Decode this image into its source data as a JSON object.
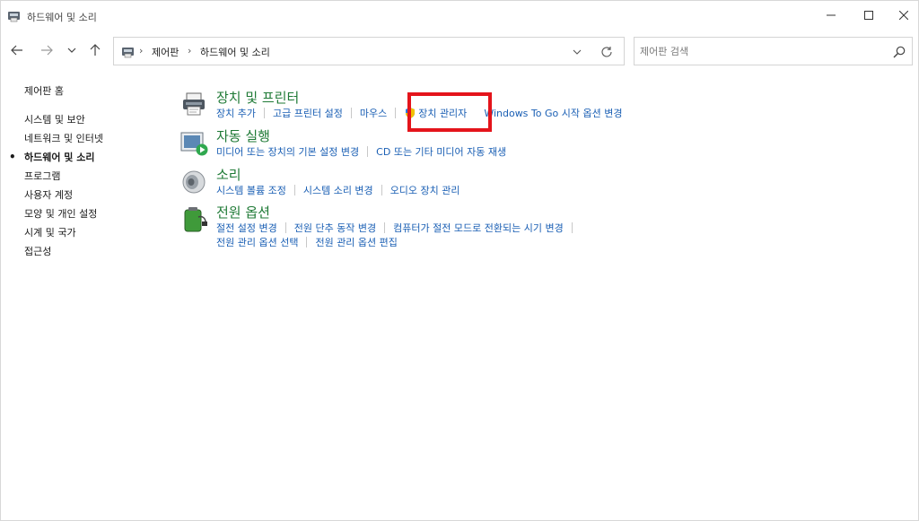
{
  "window": {
    "title": "하드웨어 및 소리",
    "controls": {
      "minimize_icon": "minimize-icon",
      "maximize_icon": "maximize-icon",
      "close_icon": "close-icon"
    }
  },
  "nav": {
    "breadcrumb": [
      "제어판",
      "하드웨어 및 소리"
    ],
    "search_placeholder": "제어판 검색"
  },
  "sidebar": {
    "home": "제어판 홈",
    "items": [
      {
        "label": "시스템 및 보안",
        "current": false
      },
      {
        "label": "네트워크 및 인터넷",
        "current": false
      },
      {
        "label": "하드웨어 및 소리",
        "current": true
      },
      {
        "label": "프로그램",
        "current": false
      },
      {
        "label": "사용자 계정",
        "current": false
      },
      {
        "label": "모양 및 개인 설정",
        "current": false
      },
      {
        "label": "시계 및 국가",
        "current": false
      },
      {
        "label": "접근성",
        "current": false
      }
    ]
  },
  "categories": {
    "devices": {
      "title": "장치 및 프린터",
      "icon": "printer-icon",
      "links": [
        "장치 추가",
        "고급 프린터 설정",
        "마우스",
        "장치 관리자",
        "Windows To Go 시작 옵션 변경"
      ]
    },
    "autoplay": {
      "title": "자동 실행",
      "icon": "autoplay-icon",
      "links": [
        "미디어 또는 장치의 기본 설정 변경",
        "CD 또는 기타 미디어 자동 재생"
      ]
    },
    "sound": {
      "title": "소리",
      "icon": "speaker-icon",
      "links": [
        "시스템 볼륨 조정",
        "시스템 소리 변경",
        "오디오 장치 관리"
      ]
    },
    "power": {
      "title": "전원 옵션",
      "icon": "battery-icon",
      "links_row1": [
        "절전 설정 변경",
        "전원 단추 동작 변경",
        "컴퓨터가 절전 모드로 전환되는 시기 변경"
      ],
      "links_row2": [
        "전원 관리 옵션 선택",
        "전원 관리 옵션 편집"
      ]
    }
  },
  "colors": {
    "category_title": "#1f7a36",
    "link": "#1a5fb4",
    "highlight": "#e4141b"
  }
}
